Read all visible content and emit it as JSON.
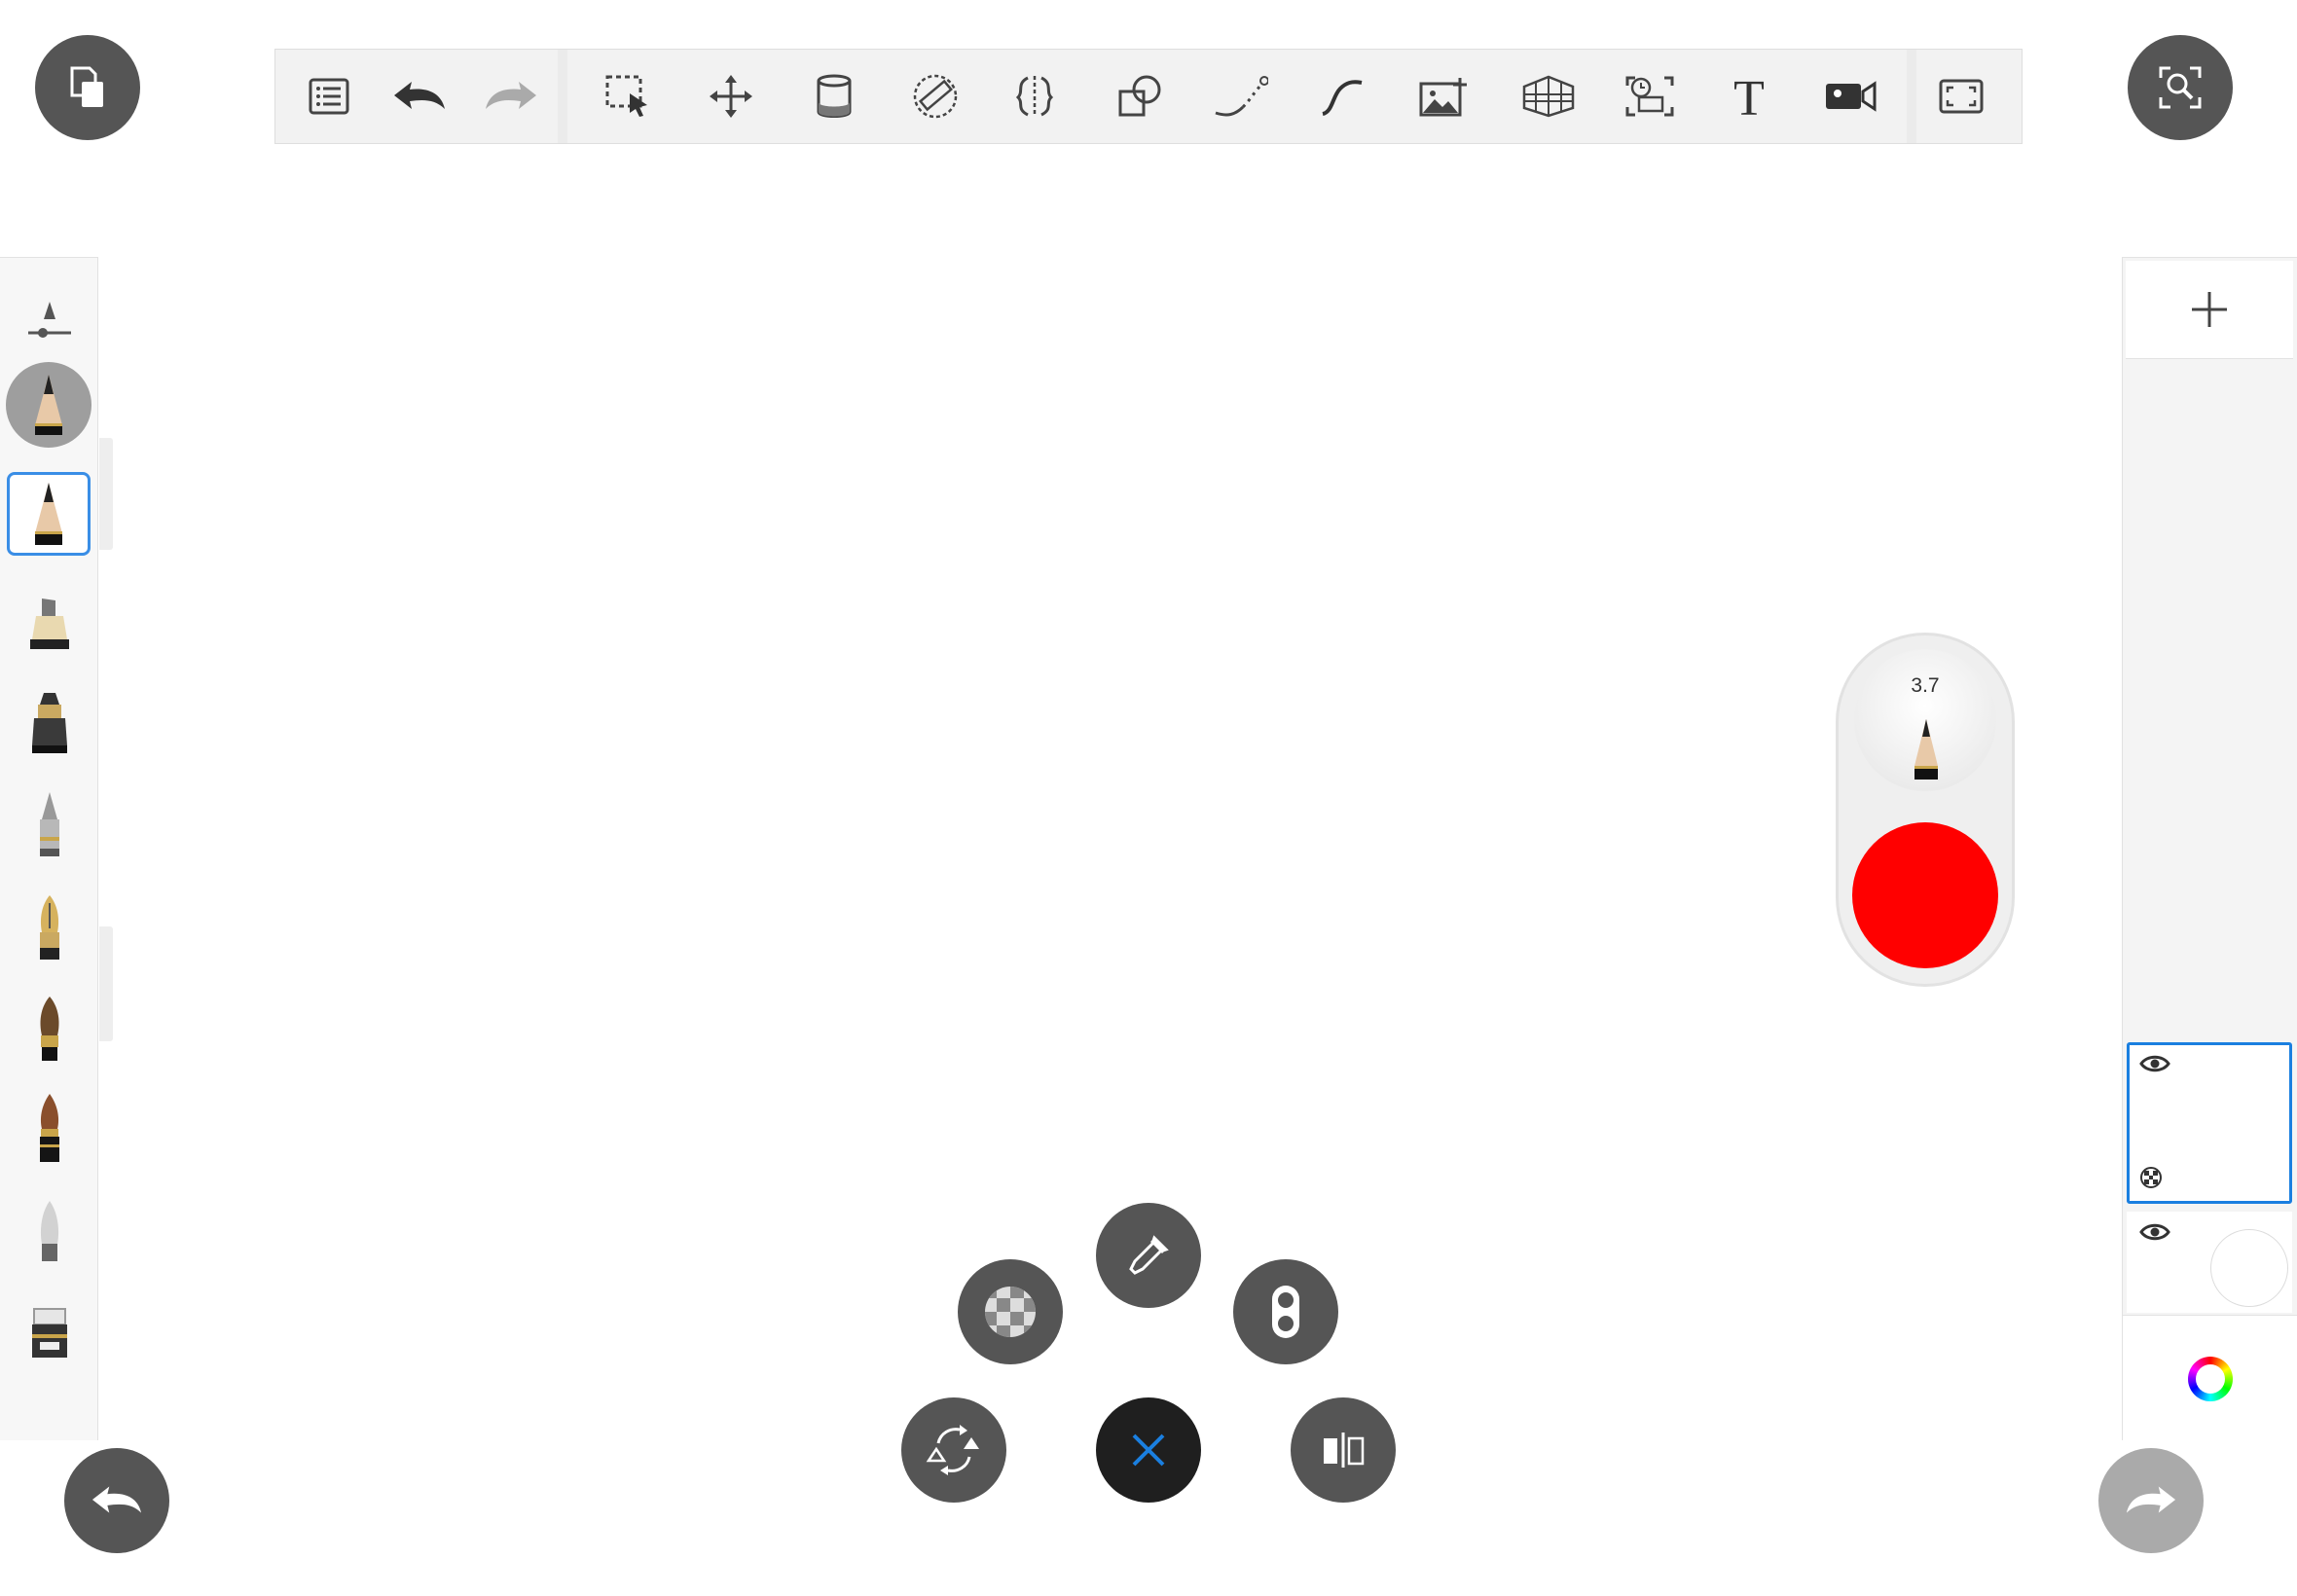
{
  "app": {
    "background": "#ffffff",
    "button_color": "#555555",
    "accent": "#1a7fe0"
  },
  "toolbar": {
    "tools": [
      "list-icon",
      "undo-icon",
      "redo-icon",
      "selection-icon",
      "transform-icon",
      "fill-bucket-icon",
      "ruler-icon",
      "symmetry-icon",
      "shape-icon",
      "dotted-stroke-icon",
      "curve-icon",
      "add-image-icon",
      "perspective-grid-icon",
      "timelapse-icon",
      "text-icon",
      "video-icon",
      "fullscreen-icon"
    ]
  },
  "brush_puck": {
    "size_value": "3.7",
    "color": "#ff0000"
  },
  "brushes": [
    "brush-properties-icon",
    "current-brush-pencil",
    "pencil",
    "marker",
    "ink-pen",
    "ballpoint",
    "fountain-pen",
    "paintbrush",
    "watercolor-brush",
    "airbrush",
    "smudge",
    "eraser"
  ],
  "layers": [
    {
      "name": "layer-1",
      "visible": true,
      "selected": true
    },
    {
      "name": "background-layer",
      "visible": true,
      "selected": false
    }
  ],
  "radial_menu": [
    "transparency",
    "eyedropper",
    "flip-layer",
    "close",
    "mirror"
  ]
}
